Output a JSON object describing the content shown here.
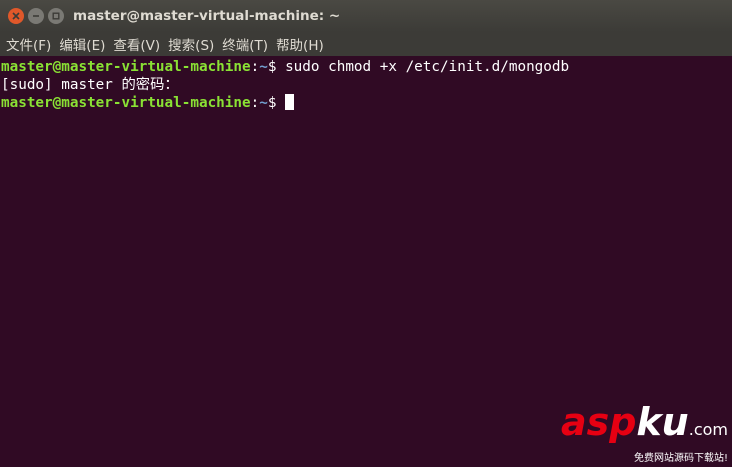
{
  "window": {
    "title": "master@master-virtual-machine: ~",
    "controls": {
      "close_icon": "close-icon",
      "minimize_icon": "minimize-icon",
      "maximize_icon": "maximize-icon",
      "close_color": "#e0582a"
    }
  },
  "menubar": {
    "items": [
      {
        "label": "文件(F)"
      },
      {
        "label": "编辑(E)"
      },
      {
        "label": "查看(V)"
      },
      {
        "label": "搜索(S)"
      },
      {
        "label": "终端(T)"
      },
      {
        "label": "帮助(H)"
      }
    ]
  },
  "terminal": {
    "background": "#300a24",
    "user_color": "#8ae234",
    "path_color": "#729fcf",
    "lines": [
      {
        "user_host": "master@master-virtual-machine",
        "colon": ":",
        "path": "~",
        "prompt": "$ ",
        "command": "sudo chmod +x /etc/init.d/mongodb"
      },
      {
        "text": "[sudo] master 的密码："
      },
      {
        "user_host": "master@master-virtual-machine",
        "colon": ":",
        "path": "~",
        "prompt": "$ ",
        "command": ""
      }
    ]
  },
  "watermark": {
    "brand_asp": "asp",
    "brand_ku": "ku",
    "brand_com": ".com",
    "tagline": "免费网站源码下载站!"
  }
}
